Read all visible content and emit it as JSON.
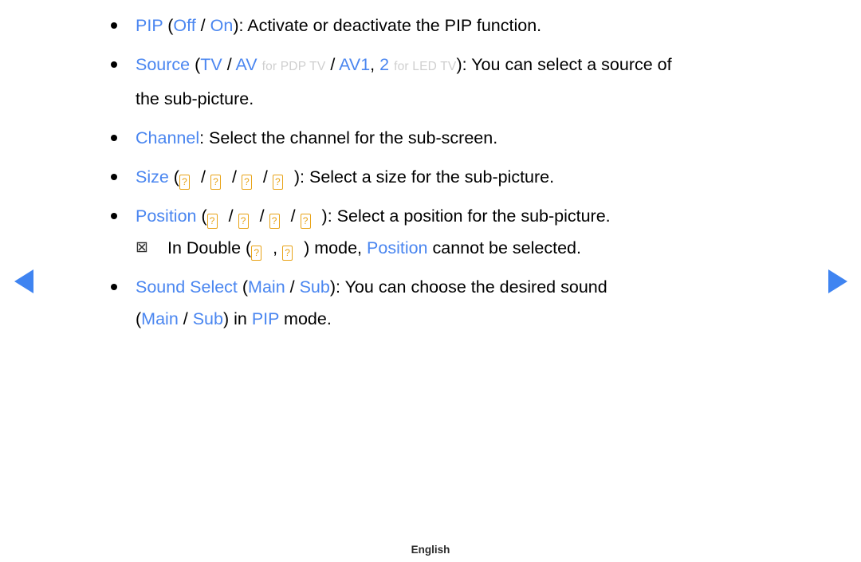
{
  "page": {
    "background": "#ffffff",
    "keyword_color": "#4a86f0",
    "annotation_color": "#cfcfcf",
    "tofu_color": "#e8a317",
    "arrow_color": "#3f84f1"
  },
  "nav": {
    "prev_label": "◀",
    "next_label": "▶"
  },
  "items": [
    {
      "id": "pip",
      "keyword": "PIP",
      "open_paren": " (",
      "opt1": "Off",
      "sep": " / ",
      "opt2": "On",
      "close": "): ",
      "description": "Activate or deactivate the PIP function."
    },
    {
      "id": "source",
      "keyword": "Source",
      "open_paren": " (",
      "opt1": "TV",
      "sep1": " / ",
      "opt2": "AV",
      "note1": "for PDP TV",
      "sep2": " / ",
      "opt3": "AV1",
      "opt3_tail": ", ",
      "opt4": "2",
      "note2": "for LED TV",
      "close": "): ",
      "description": "You can select a source of",
      "description_line2": "the sub-picture."
    },
    {
      "id": "channel",
      "keyword": "Channel",
      "close": ": ",
      "description": "Select the channel for the sub-screen."
    },
    {
      "id": "size",
      "keyword": "Size",
      "open_paren": " (",
      "glyph": "?",
      "glyph_count": 4,
      "sep": "/",
      "close": "): ",
      "description": "Select a size for the sub-picture."
    },
    {
      "id": "position",
      "keyword": "Position",
      "open_paren": " (",
      "glyph": "?",
      "glyph_count": 4,
      "sep": "/",
      "close": "): ",
      "description": "Select a position for the sub-picture."
    }
  ],
  "note": {
    "marker": "⊠",
    "text_before": "In Double (",
    "glyph": "?",
    "glyph_sep": ",",
    "text_mid": ") mode, ",
    "keyword": "Position",
    "text_after": " cannot be selected."
  },
  "sound_select": {
    "keyword": "Sound Select",
    "open_paren": " (",
    "opt1": "Main",
    "sep": " / ",
    "opt2": "Sub",
    "close": "): ",
    "description": "You can choose the desired sound",
    "line2_open": "(",
    "line2_opt1": "Main",
    "line2_sep": " / ",
    "line2_opt2": "Sub",
    "line2_mid": ") in ",
    "line2_keyword": "PIP",
    "line2_tail": " mode."
  },
  "footer": {
    "language": "English"
  }
}
